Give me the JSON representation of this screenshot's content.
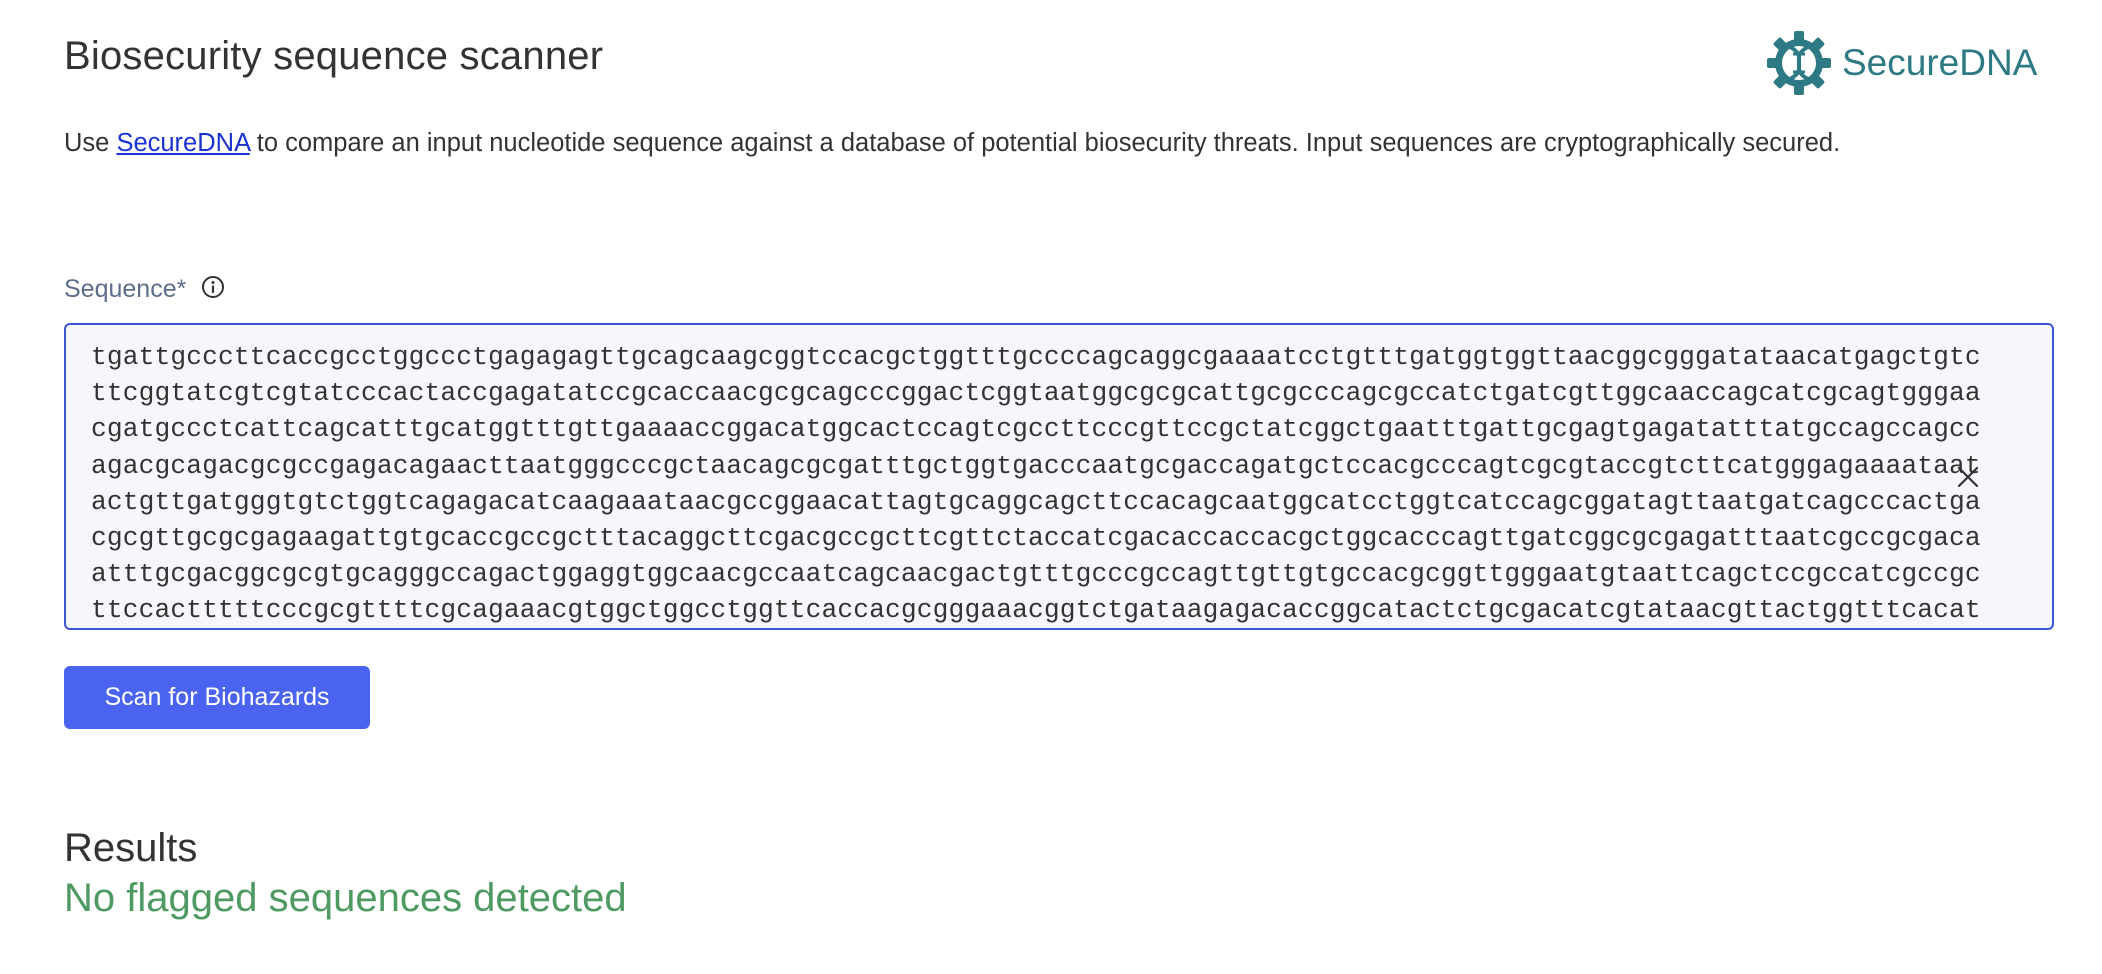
{
  "header": {
    "title": "Biosecurity sequence scanner",
    "brand_name": "SecureDNA",
    "brand_icon": "dna-gear-logo-icon",
    "brand_color": "#2e7a84"
  },
  "intro": {
    "prefix": "Use ",
    "link_text": "SecureDNA",
    "suffix": " to compare an input nucleotide sequence against a database of potential biosecurity threats. Input sequences are cryptographically secured."
  },
  "sequence": {
    "label": "Sequence*",
    "info_icon": "info-circle-icon",
    "clear_icon": "close-icon",
    "lines": [
      "tgattgcccttcaccgcctggccctgagagagttgcagcaagcggtccacgctggtttgccccagcaggcgaaaatcctgtttgatggtggttaacggcgggatataacatgagctgtc",
      "ttcggtatcgtcgtatcccactaccgagatatccgcaccaacgcgcagcccggactcggtaatggcgcgcattgcgcccagcgccatctgatcgttggcaaccagcatcgcagtgggaa",
      "cgatgccctcattcagcatttgcatggtttgttgaaaaccggacatggcactccagtcgccttcccgttccgctatcggctgaatttgattgcgagtgagatatttatgccagccagcc",
      "agacgcagacgcgccgagacagaacttaatgggcccgctaacagcgcgatttgctggtgacccaatgcgaccagatgctccacgcccagtcgcgtaccgtcttcatgggagaaaataat",
      "actgttgatgggtgtctggtcagagacatcaagaaataacgccggaacattagtgcaggcagcttccacagcaatggcatcctggtcatccagcggatagttaatgatcagcccactga",
      "cgcgttgcgcgagaagattgtgcaccgccgctttacaggcttcgacgccgcttcgttctaccatcgacaccaccacgctggcacccagttgatcggcgcgagatttaatcgccgcgaca",
      "atttgcgacggcgcgtgcagggccagactggaggtggcaacgccaatcagcaacgactgtttgcccgccagttgttgtgccacgcggttgggaatgtaattcagctccgccatcgccgc",
      "ttccactttttcccgcgttttcgcagaaacgtggctggcctggttcaccacgcgggaaacggtctgataagagacaccggcatactctgcgacatcgtataacgttactggtttcacat"
    ]
  },
  "actions": {
    "scan_label": "Scan for Biohazards",
    "scan_color": "#4a63f0"
  },
  "results": {
    "heading": "Results",
    "status": "No flagged sequences detected",
    "status_color": "#4e9a62"
  }
}
